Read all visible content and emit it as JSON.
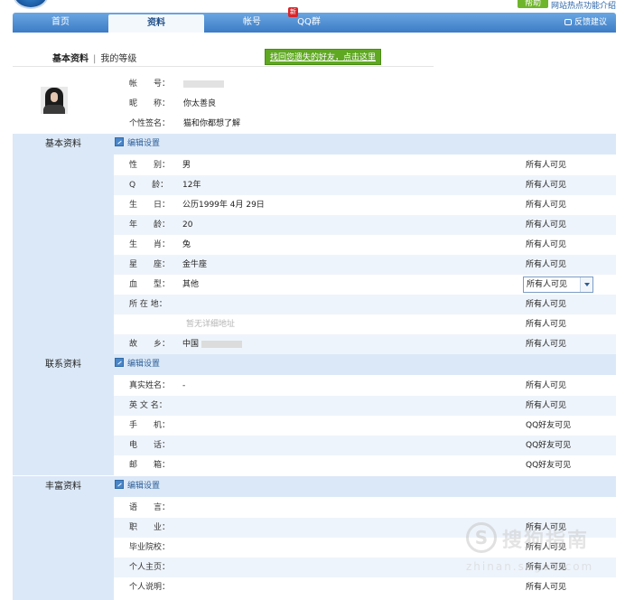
{
  "top": {
    "help_label": "帮助",
    "hot_link": "网站热点功能介绍"
  },
  "nav": {
    "tabs": [
      {
        "label": "首页"
      },
      {
        "label": "资料"
      },
      {
        "label": "帐号"
      },
      {
        "label": "QQ群"
      }
    ],
    "new_badge": "新",
    "active_tab": "资料",
    "feedback": "反馈建议"
  },
  "subnav": {
    "basic": "基本资料",
    "separator": "|",
    "level": "我的等级",
    "find_friends": "找回您遗失的好友，点击这里"
  },
  "profile": {
    "account_label": "帐　　号：",
    "nickname_label": "昵　　称：",
    "nickname": "你太善良",
    "signature_label": "个性签名：",
    "signature": "猫和你都想了解"
  },
  "sections": {
    "basic": {
      "title": "基本资料",
      "edit": "编辑设置",
      "rows": [
        {
          "label": "性　　别：",
          "value": "男",
          "visibility": "所有人可见"
        },
        {
          "label": "Q　　龄：",
          "value": "12年",
          "visibility": "所有人可见"
        },
        {
          "label": "生　　日：",
          "value": "公历1999年 4月 29日",
          "visibility": "所有人可见"
        },
        {
          "label": "年　　龄：",
          "value": "20",
          "visibility": "所有人可见"
        },
        {
          "label": "生　　肖：",
          "value": "兔",
          "visibility": "所有人可见"
        },
        {
          "label": "星　　座：",
          "value": "金牛座",
          "visibility": "所有人可见"
        },
        {
          "label": "血　　型：",
          "value": "其他",
          "visibility": "所有人可见"
        },
        {
          "label": "所 在 地：",
          "value": "",
          "visibility": "所有人可见"
        },
        {
          "label": "",
          "value": "暂无详细地址",
          "visibility": "所有人可见"
        },
        {
          "label": "故　　乡：",
          "value": "中国",
          "visibility": "所有人可见"
        }
      ]
    },
    "contact": {
      "title": "联系资料",
      "edit": "编辑设置",
      "rows": [
        {
          "label": "真实姓名：",
          "value": "-",
          "visibility": "所有人可见"
        },
        {
          "label": "英 文 名：",
          "value": "",
          "visibility": "所有人可见"
        },
        {
          "label": "手　　机：",
          "value": "",
          "visibility": "QQ好友可见"
        },
        {
          "label": "电　　话：",
          "value": "",
          "visibility": "QQ好友可见"
        },
        {
          "label": "邮　　箱：",
          "value": "",
          "visibility": "QQ好友可见"
        }
      ]
    },
    "rich": {
      "title": "丰富资料",
      "edit": "编辑设置",
      "rows": [
        {
          "label": "语　　言：",
          "value": "",
          "visibility": ""
        },
        {
          "label": "职　　业：",
          "value": "",
          "visibility": "所有人可见"
        },
        {
          "label": "毕业院校：",
          "value": "",
          "visibility": "所有人可见"
        },
        {
          "label": "个人主页：",
          "value": "",
          "visibility": "所有人可见"
        },
        {
          "label": "个人说明：",
          "value": "",
          "visibility": "所有人可见"
        }
      ]
    }
  },
  "watermark": {
    "text": "搜狗指南",
    "url": "zhinan.sogou.com"
  }
}
